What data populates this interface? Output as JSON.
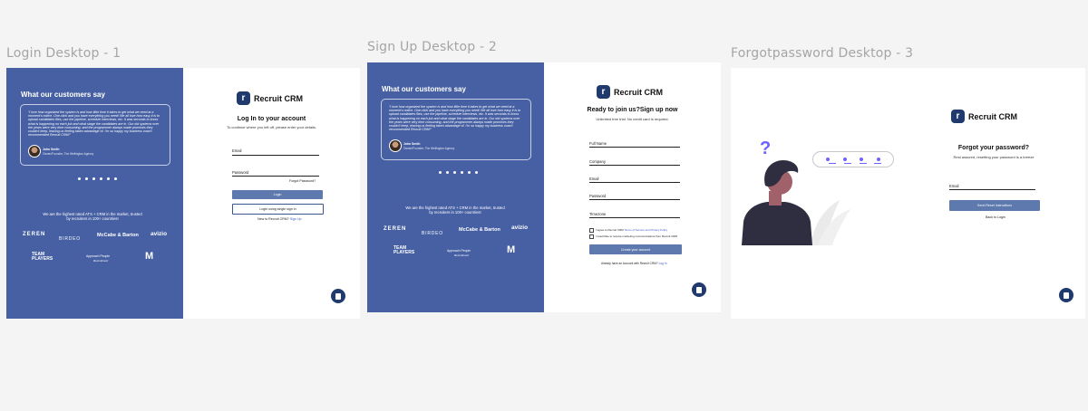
{
  "frames": {
    "login": {
      "title": "Login Desktop - 1"
    },
    "signup": {
      "title": "Sign Up Desktop - 2"
    },
    "forgot": {
      "title": "Forgotpassword Desktop - 3"
    }
  },
  "brand": {
    "name": "Recruit CRM",
    "icon_letter": "r"
  },
  "testimonial": {
    "heading": "What our customers say",
    "quote": "“I love how organized the system is and how little time it takes to get what we need at a moment’s notice. One-click and you have everything you need! We all love how easy it is to upload candidates files, use the pipeline, schedule interviews, etc. It was seconds to know what is happening on each job and what stage the candidates are in. Our old systems over the years were very time consuming, and the programmer always made promises they couldn’t keep, leaving us feeling taken advantage of. I’m so happy my business coach recommended Recruit CRM!”",
    "author_name": "John Smith",
    "author_role": "Owner/Founder, The Wellington Agency",
    "dots": 6
  },
  "rated_text": "We are the highest rated ATS + CRM in the market, trusted by recruiters in 100+ countries!",
  "client_logos": {
    "zeren": "ZEREN",
    "birdeo": "BIRDEO",
    "mccabe": "McCabe & Barton",
    "avizio": "avizio",
    "team_players": "TEAM PLAYERS",
    "approach_people": "Approach People",
    "approach_sub": "Recruitment",
    "m_logo": "M"
  },
  "login": {
    "title": "Log In to your account",
    "subtitle": "To continue where you left off, please enter your details.",
    "email_label": "Email",
    "password_label": "Password",
    "forgot_link": "Forgot Password?",
    "login_button": "Login",
    "google_button": "Login using single sign in",
    "signup_prompt": "New to Recruit CRM?",
    "signup_link": "Sign Up"
  },
  "signup": {
    "title": "Ready to join us?Sign up now",
    "subtitle": "Unlimited free trial. No credit card is required.",
    "fields": [
      "Full Name",
      "Company",
      "Email",
      "Password",
      "Timezone"
    ],
    "terms_text": "I agree to Recruit CRM",
    "terms_link": "Terms of Service and Privacy Policy",
    "marketing_text": "I would like to receive marketing communications from Recruit CRM",
    "create_button": "Create your account",
    "login_prompt": "Already have an Account with Recruit CRM?",
    "login_link": "Log In"
  },
  "forgot": {
    "title": "Forgot your password?",
    "subtitle": "Rest assured, resetting your password is a breeze",
    "email_label": "Email",
    "send_button": "Send Reset Instructions",
    "back_link": "Back to Login",
    "question_mark": "?"
  },
  "colors": {
    "panel_blue": "#4660a3",
    "brand_navy": "#213a6d",
    "button_blue": "#5d79ad",
    "accent_purple": "#6c63ff"
  }
}
